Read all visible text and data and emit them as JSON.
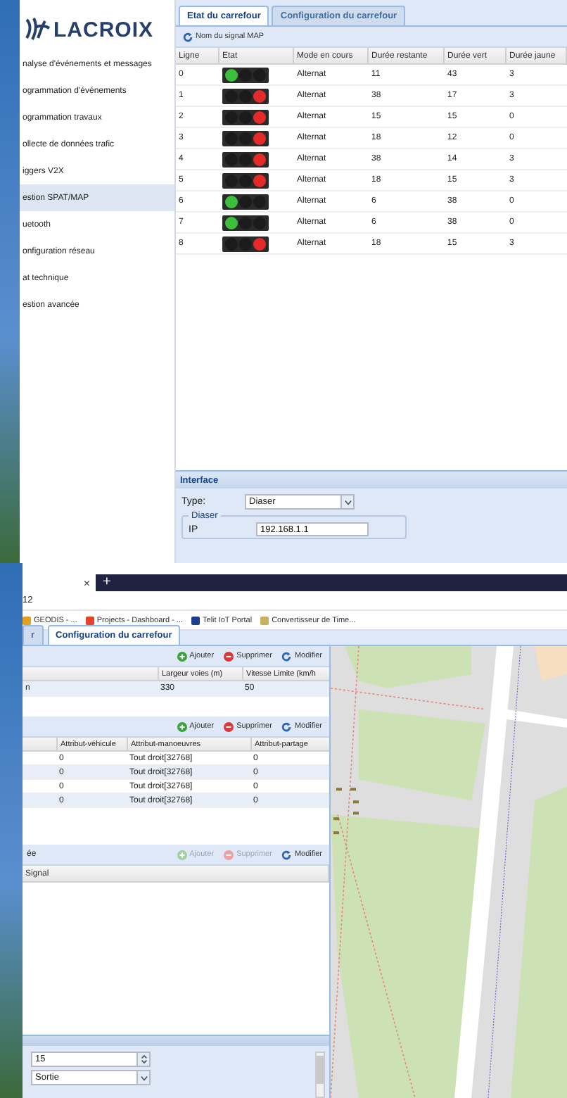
{
  "sidebar": {
    "logo": "LACROIX",
    "items": [
      {
        "label": "nalyse d'événements et messages",
        "selected": false
      },
      {
        "label": "ogrammation d'événements",
        "selected": false
      },
      {
        "label": "ogrammation travaux",
        "selected": false
      },
      {
        "label": "ollecte de données trafic",
        "selected": false
      },
      {
        "label": "iggers V2X",
        "selected": false
      },
      {
        "label": "estion SPAT/MAP",
        "selected": true
      },
      {
        "label": "uetooth",
        "selected": false
      },
      {
        "label": "onfiguration réseau",
        "selected": false
      },
      {
        "label": "at technique",
        "selected": false
      },
      {
        "label": "estion avancée",
        "selected": false
      }
    ]
  },
  "tabs": [
    {
      "label": "Etat du carrefour",
      "selected": true
    },
    {
      "label": "Configuration du carrefour",
      "selected": false
    }
  ],
  "toolbar_button": "Nom du signal MAP",
  "signal_table": {
    "columns": [
      "Ligne",
      "Etat",
      "Mode en cours",
      "Durée restante",
      "Durée vert",
      "Durée jaune"
    ],
    "rows": [
      {
        "ligne": "0",
        "kind": "green",
        "mode": "Alternat",
        "restante": "11",
        "vert": "43",
        "jaune": "3"
      },
      {
        "ligne": "1",
        "kind": "red",
        "mode": "Alternat",
        "restante": "38",
        "vert": "17",
        "jaune": "3"
      },
      {
        "ligne": "2",
        "kind": "red",
        "mode": "Alternat",
        "restante": "15",
        "vert": "15",
        "jaune": "0"
      },
      {
        "ligne": "3",
        "kind": "red",
        "mode": "Alternat",
        "restante": "18",
        "vert": "12",
        "jaune": "0"
      },
      {
        "ligne": "4",
        "kind": "red",
        "mode": "Alternat",
        "restante": "38",
        "vert": "14",
        "jaune": "3"
      },
      {
        "ligne": "5",
        "kind": "red",
        "mode": "Alternat",
        "restante": "18",
        "vert": "15",
        "jaune": "3"
      },
      {
        "ligne": "6",
        "kind": "green",
        "mode": "Alternat",
        "restante": "6",
        "vert": "38",
        "jaune": "0"
      },
      {
        "ligne": "7",
        "kind": "green",
        "mode": "Alternat",
        "restante": "6",
        "vert": "38",
        "jaune": "0"
      },
      {
        "ligne": "8",
        "kind": "red",
        "mode": "Alternat",
        "restante": "18",
        "vert": "15",
        "jaune": "3"
      }
    ]
  },
  "interface": {
    "title": "Interface",
    "type_label": "Type:",
    "type_value": "Diaser",
    "fieldset": "Diaser",
    "ip_label": "IP",
    "ip_value": "192.168.1.1"
  },
  "browser": {
    "tab_close": "×",
    "new_tab": "+",
    "address": "12",
    "bookmarks": [
      "GEODIS - ...",
      "Projects - Dashboard - ...",
      "Telit IoT Portal",
      "Convertisseur de Time..."
    ],
    "tabs": [
      {
        "label": "r",
        "selected": false
      },
      {
        "label": "Configuration du carrefour",
        "selected": true
      }
    ]
  },
  "lanes_panel": {
    "buttons": [
      {
        "label": "Ajouter",
        "disabled": false
      },
      {
        "label": "Supprimer",
        "disabled": false
      },
      {
        "label": "Modifier",
        "disabled": false
      }
    ],
    "columns": [
      "Largeur voies (m)",
      "Vitesse Limite (km/h"
    ],
    "rows": [
      {
        "name": "n",
        "cells": [
          "330",
          "50"
        ]
      }
    ]
  },
  "attributes_panel": {
    "buttons": [
      {
        "label": "Ajouter",
        "disabled": false
      },
      {
        "label": "Supprimer",
        "disabled": false
      },
      {
        "label": "Modifier",
        "disabled": false
      }
    ],
    "columns": [
      "Attribut-véhicule",
      "Attribut-manoeuvres",
      "Attribut-partage"
    ],
    "rows": [
      [
        "0",
        "Tout droit[32768]",
        "0"
      ],
      [
        "0",
        "Tout droit[32768]",
        "0"
      ],
      [
        "0",
        "Tout droit[32768]",
        "0"
      ],
      [
        "0",
        "Tout droit[32768]",
        "0"
      ]
    ]
  },
  "signals_panel": {
    "title": "ée",
    "buttons": [
      {
        "label": "Ajouter",
        "disabled": true
      },
      {
        "label": "Supprimer",
        "disabled": true
      },
      {
        "label": "Modifier",
        "disabled": false
      }
    ],
    "columns": [
      "Signal"
    ]
  },
  "form": {
    "fields": [
      {
        "kind": "spinner",
        "value": "15"
      },
      {
        "kind": "combo",
        "value": "Sortie"
      }
    ]
  }
}
